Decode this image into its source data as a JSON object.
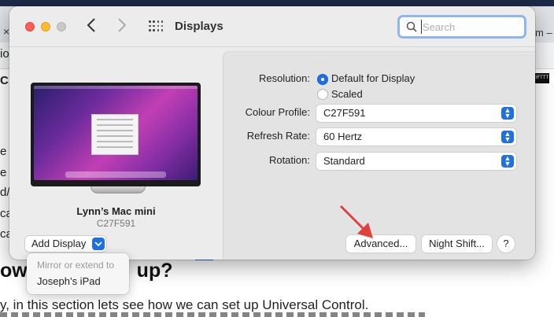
{
  "window": {
    "title": "Displays",
    "search_placeholder": "Search"
  },
  "monitor": {
    "name": "Lynn’s Mac mini",
    "model": "C27F591"
  },
  "settings": {
    "resolution_label": "Resolution:",
    "resolution_options": [
      {
        "label": "Default for Display",
        "selected": true
      },
      {
        "label": "Scaled",
        "selected": false
      }
    ],
    "colour_profile_label": "Colour Profile:",
    "colour_profile_value": "C27F591",
    "refresh_rate_label": "Refresh Rate:",
    "refresh_rate_value": "60 Hertz",
    "rotation_label": "Rotation:",
    "rotation_value": "Standard"
  },
  "buttons": {
    "advanced": "Advanced...",
    "night_shift": "Night Shift...",
    "help": "?"
  },
  "add_display": {
    "label": "Add Display",
    "menu_header": "Mirror or extend to",
    "menu_items": [
      "Joseph’s iPad"
    ]
  },
  "background_page": {
    "tab_fragment": "m –",
    "heading_fragment": "ow",
    "heading_fragment_2": "up?",
    "paragraph_fragment": "y, in this section lets see how we can set up Universal Control.",
    "left_fragments": [
      "io",
      "e",
      "e",
      "d/",
      "ca",
      "ca"
    ]
  },
  "colors": {
    "accent": "#1f6fe5",
    "search_focus": "#8eb6ee",
    "annotation_arrow": "#e0413a"
  }
}
